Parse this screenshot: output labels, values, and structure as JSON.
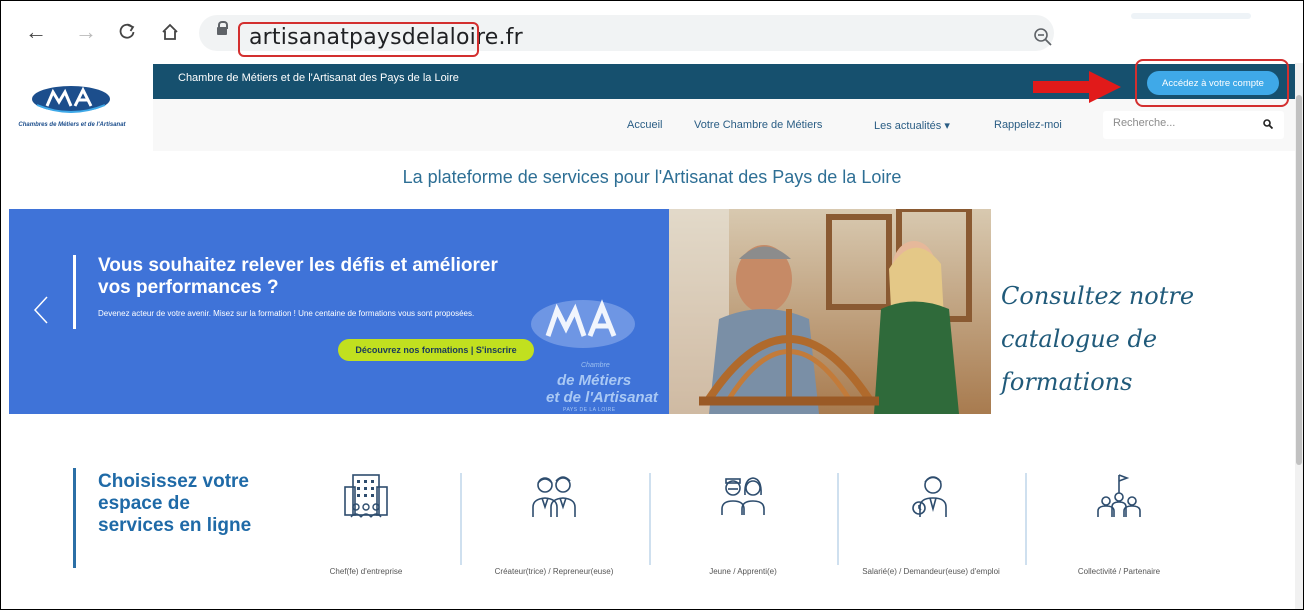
{
  "browser": {
    "url": "artisanatpaysdelaloire.fr"
  },
  "site": {
    "topbar_text": "Chambre de Métiers et de l'Artisanat des Pays de la Loire",
    "logo_subtitle": "Chambres de Métiers et de l'Artisanat",
    "account_button": "Accédez à votre compte",
    "nav": [
      {
        "label": "Accueil"
      },
      {
        "label": "Votre Chambre de Métiers"
      },
      {
        "label": "Les actualités ▾"
      },
      {
        "label": "Rappelez-moi"
      }
    ],
    "search_placeholder": "Recherche...",
    "tagline": "La plateforme de services pour l'Artisanat des Pays de la Loire"
  },
  "banner": {
    "heading": "Vous souhaitez relever les défis et améliorer vos performances ?",
    "text": "Devenez acteur de votre avenir. Misez sur la formation ! Une centaine de formations vous sont proposées.",
    "cta": "Découvrez nos formations | S'inscrire",
    "watermark_chambre": "Chambre",
    "watermark_metiers": "de Métiers",
    "watermark_artisanat": "et de l'Artisanat",
    "watermark_sub": "PAYS DE LA LOIRE",
    "catalog": "Consultez notre catalogue de formations"
  },
  "espaces": {
    "title": "Choisissez votre espace de services en ligne",
    "items": [
      {
        "label": "Chef(fe) d'entreprise",
        "icon": "building-icon"
      },
      {
        "label": "Créateur(trice) / Repreneur(euse)",
        "icon": "two-people-icon"
      },
      {
        "label": "Jeune / Apprenti(e)",
        "icon": "young-people-icon"
      },
      {
        "label": "Salarié(e) / Demandeur(euse) d'emploi",
        "icon": "employee-icon"
      },
      {
        "label": "Collectivité / Partenaire",
        "icon": "team-flag-icon"
      }
    ]
  },
  "colors": {
    "header_blue": "#16506e",
    "banner_blue": "#3f73d8",
    "account_button": "#3fa9e8",
    "cta_green": "#c1e01f",
    "highlight_red": "#d32f2f"
  }
}
